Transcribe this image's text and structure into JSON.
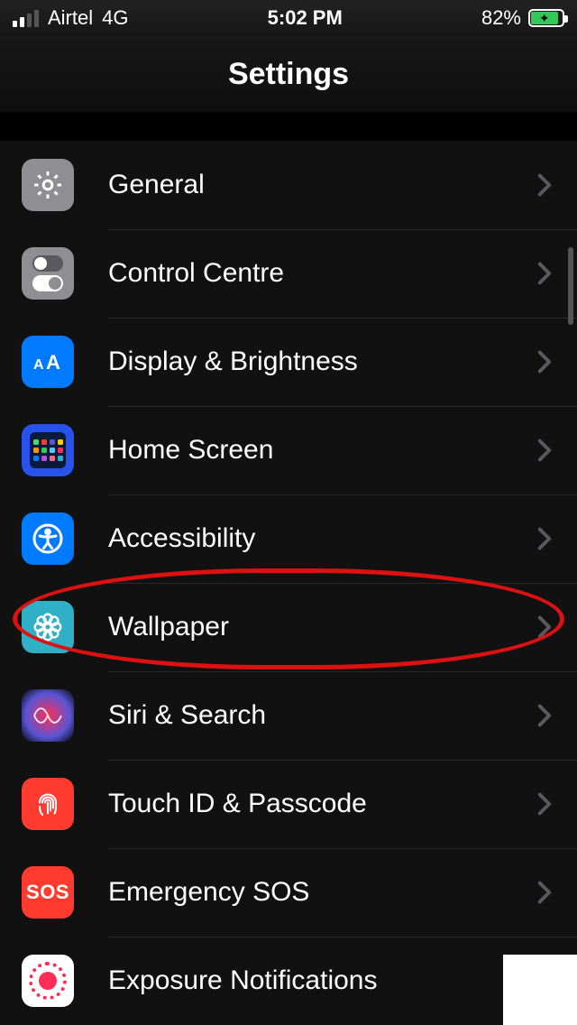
{
  "status": {
    "carrier": "Airtel",
    "network": "4G",
    "time": "5:02 PM",
    "battery_percent": "82%"
  },
  "header": {
    "title": "Settings"
  },
  "rows": [
    {
      "id": "general",
      "label": "General"
    },
    {
      "id": "control",
      "label": "Control Centre"
    },
    {
      "id": "display",
      "label": "Display & Brightness"
    },
    {
      "id": "home",
      "label": "Home Screen"
    },
    {
      "id": "accessibility",
      "label": "Accessibility"
    },
    {
      "id": "wallpaper",
      "label": "Wallpaper"
    },
    {
      "id": "siri",
      "label": "Siri & Search"
    },
    {
      "id": "touchid",
      "label": "Touch ID & Passcode"
    },
    {
      "id": "sos",
      "label": "Emergency SOS"
    },
    {
      "id": "exposure",
      "label": "Exposure Notifications"
    }
  ],
  "home_icon_colors": [
    "#4cd964",
    "#ff3b30",
    "#5856d6",
    "#ffcc00",
    "#ff9500",
    "#34c759",
    "#5ac8fa",
    "#ff2d55",
    "#007aff",
    "#af52de",
    "#ff6482",
    "#30b0c7"
  ],
  "highlight": {
    "target": "wallpaper",
    "color": "#d11"
  }
}
